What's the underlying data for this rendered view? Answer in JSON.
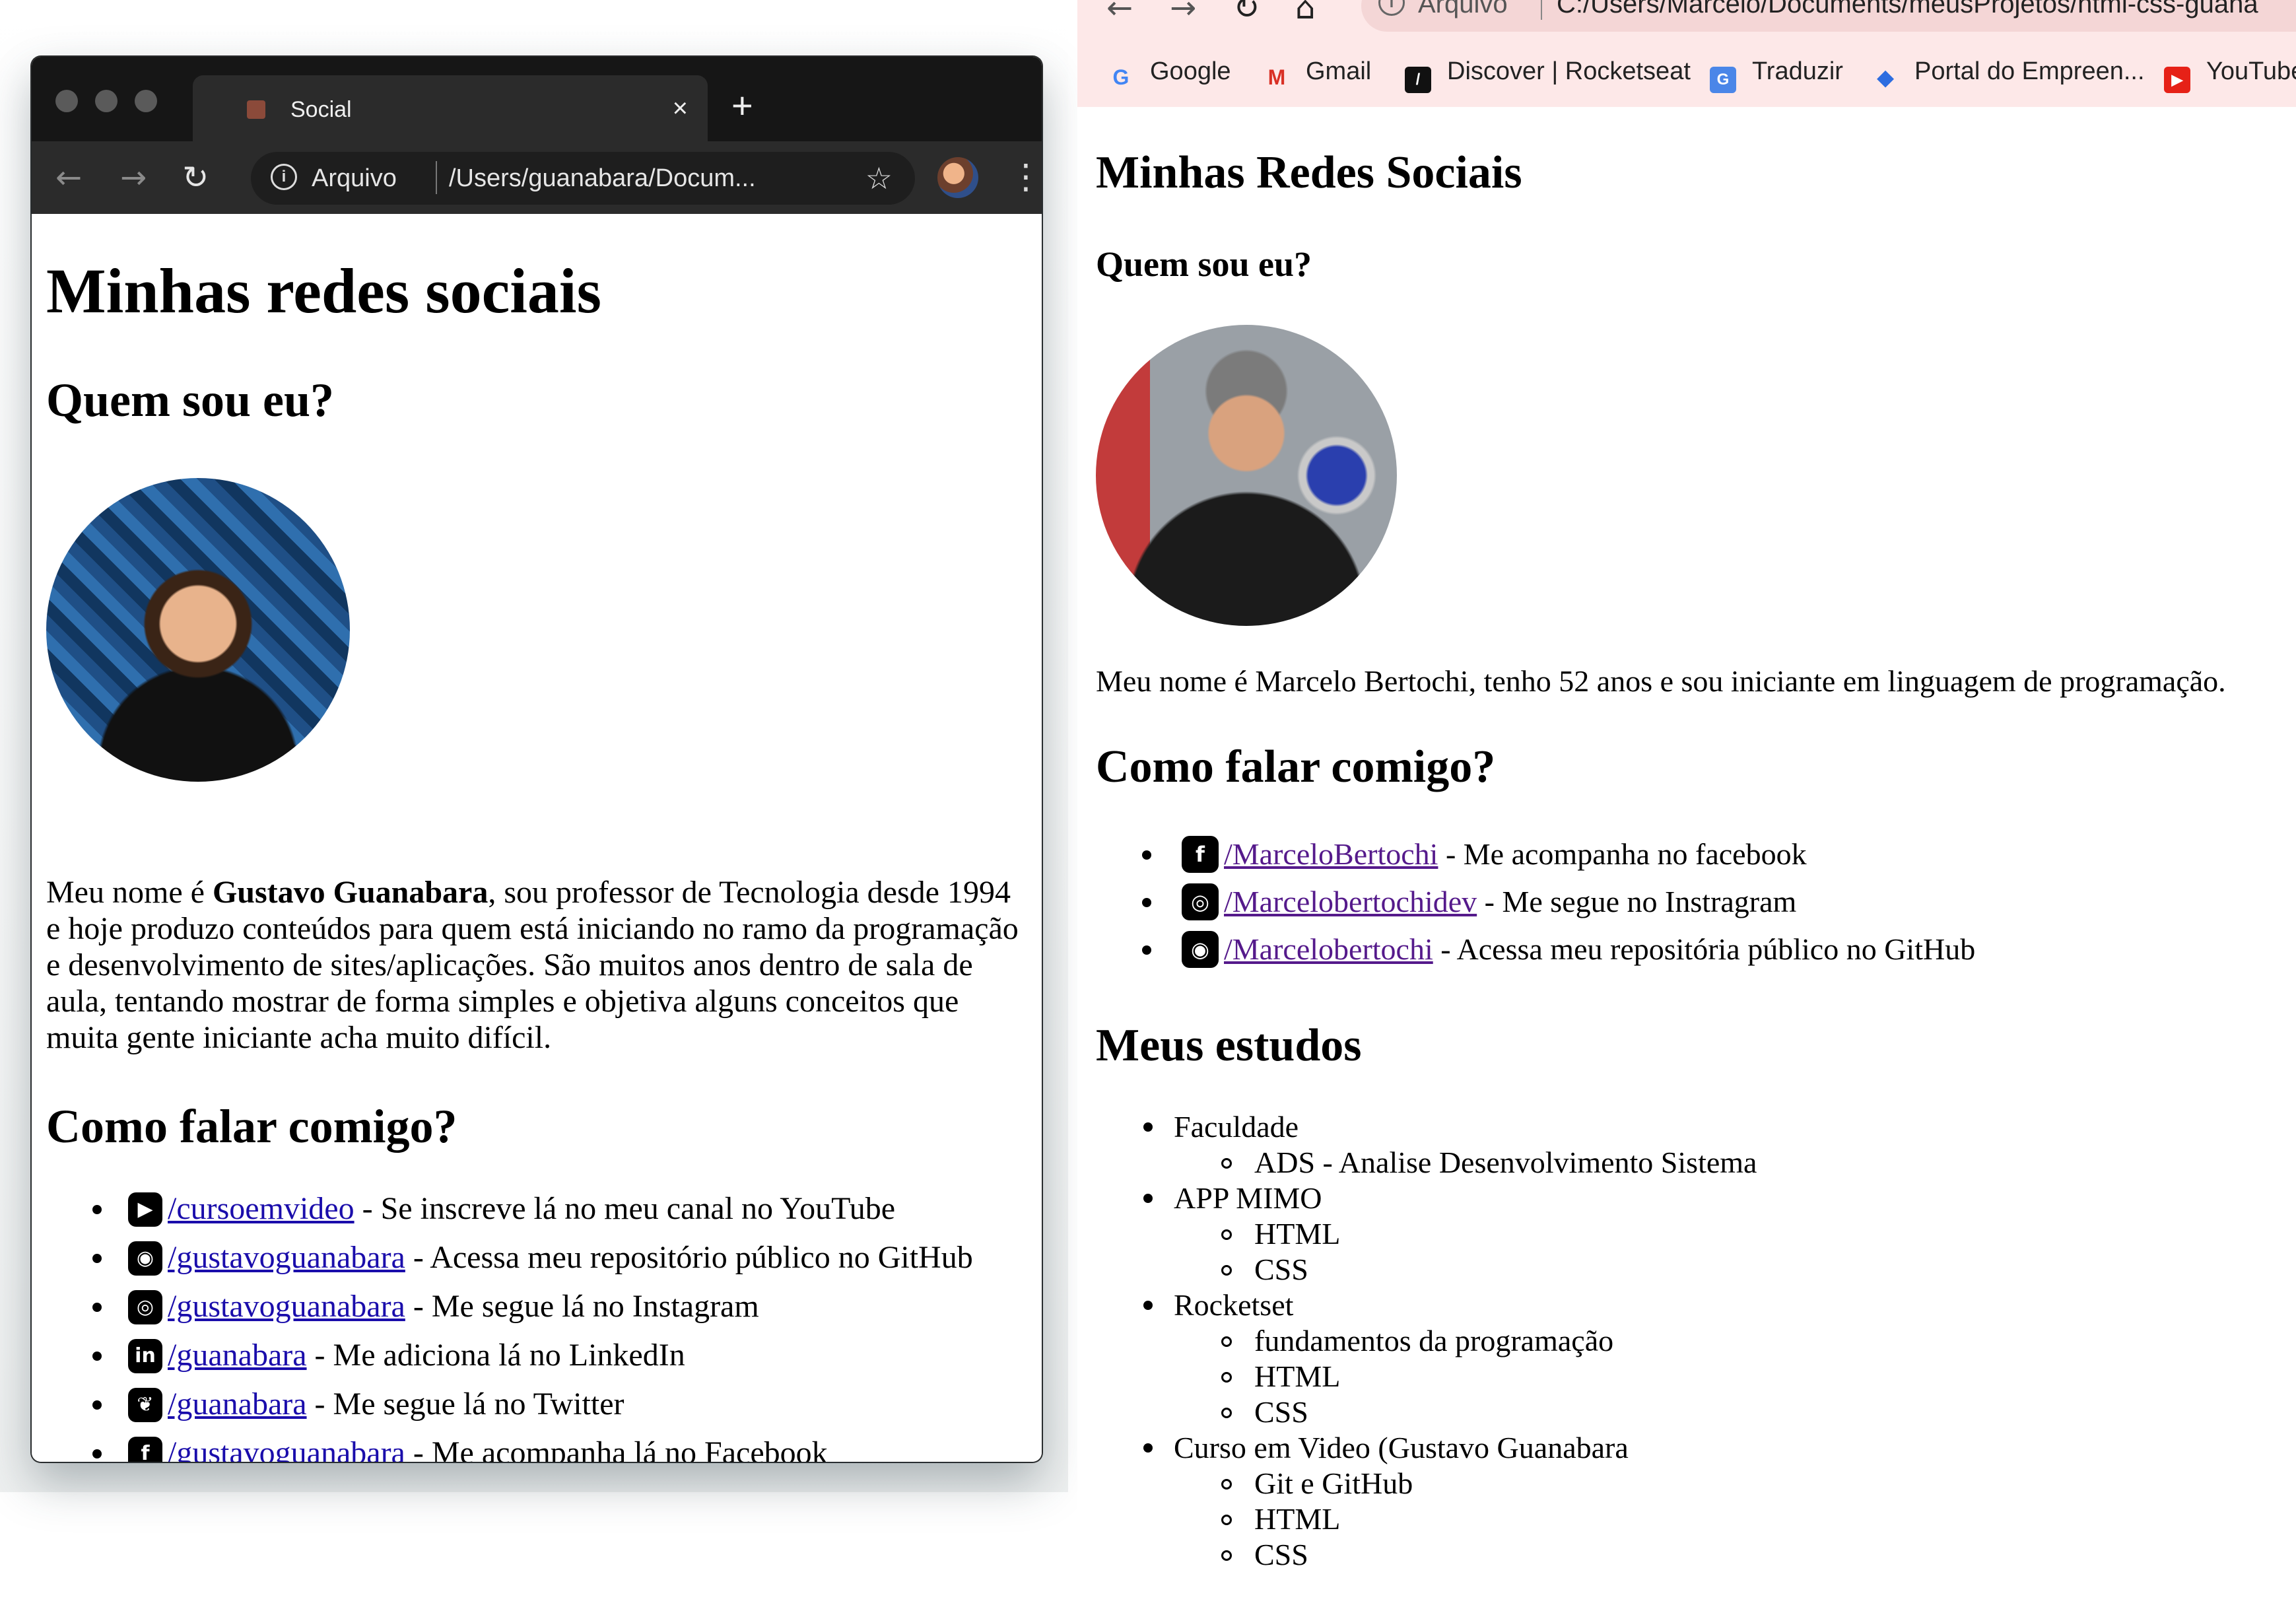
{
  "left": {
    "tab_title": "Social",
    "tab_close": "×",
    "new_tab": "+",
    "omnibox_scheme": "Arquivo",
    "omnibox_url": "/Users/guanabara/Docum...",
    "heading": "Minhas redes sociais",
    "subheading_who": "Quem sou eu?",
    "bio_prefix": "Meu nome é ",
    "bio_name": "Gustavo Guanabara",
    "bio_rest": ", sou professor de Tecnologia desde 1994 e hoje produzo conteúdos para quem está iniciando no ramo da programação e desenvolvimento de sites/aplicações. São muitos anos dentro de sala de aula, tentando mostrar de forma simples e objetiva alguns conceitos que muita gente iniciante acha muito difícil.",
    "subheading_contact": "Como falar comigo?",
    "links": [
      {
        "icon": "youtube-icon",
        "link": "/cursoemvideo",
        "text": " - Se inscreve lá no meu canal no YouTube"
      },
      {
        "icon": "github-icon",
        "link": "/gustavoguanabara",
        "text": " - Acessa meu repositório público no GitHub"
      },
      {
        "icon": "instagram-icon",
        "link": "/gustavoguanabara",
        "text": " - Me segue lá no Instagram"
      },
      {
        "icon": "linkedin-icon",
        "link": "/guanabara",
        "text": " - Me adiciona lá no LinkedIn"
      },
      {
        "icon": "twitter-icon",
        "link": "/guanabara",
        "text": " - Me segue lá no Twitter"
      },
      {
        "icon": "facebook-icon",
        "link": "/gustavoguanabara",
        "text": " - Me acompanha lá no Facebook"
      }
    ]
  },
  "right": {
    "omnibox_scheme": "Arquivo",
    "omnibox_url": "C:/Users/Marcelo/Documents/meusProjetos/html-css-guana",
    "bookmarks": [
      {
        "icon": "google-icon",
        "label": "Google"
      },
      {
        "icon": "gmail-icon",
        "label": "Gmail"
      },
      {
        "icon": "rocketseat-icon",
        "label": "Discover | Rocketseat"
      },
      {
        "icon": "translate-icon",
        "label": "Traduzir"
      },
      {
        "icon": "portal-icon",
        "label": "Portal do Empreen..."
      },
      {
        "icon": "youtube-icon",
        "label": "YouTube"
      }
    ],
    "heading": "Minhas Redes Sociais",
    "subheading_who": "Quem sou eu?",
    "bio": "Meu nome é Marcelo Bertochi, tenho 52 anos e sou iniciante em linguagem de programação.",
    "subheading_contact": "Como falar comigo?",
    "links": [
      {
        "icon": "facebook-icon",
        "link": "/MarceloBertochi",
        "text": " - Me acompanha no facebook"
      },
      {
        "icon": "instagram-icon",
        "link": "/Marcelobertochidev",
        "text": " - Me segue no Instragram"
      },
      {
        "icon": "github-icon",
        "link": "/Marcelobertochi",
        "text": " - Acessa meu repositória público no GitHub"
      }
    ],
    "subheading_studies": "Meus estudos",
    "studies": [
      {
        "label": "Faculdade",
        "items": [
          "ADS - Analise Desenvolvimento Sistema"
        ]
      },
      {
        "label": "APP MIMO",
        "items": [
          "HTML",
          "CSS"
        ]
      },
      {
        "label": "Rocketset",
        "items": [
          "fundamentos da programação",
          "HTML",
          "CSS"
        ]
      },
      {
        "label": "Curso em Video (Gustavo Guanabara",
        "items": [
          "Git e GitHub",
          "HTML",
          "CSS"
        ]
      }
    ]
  }
}
